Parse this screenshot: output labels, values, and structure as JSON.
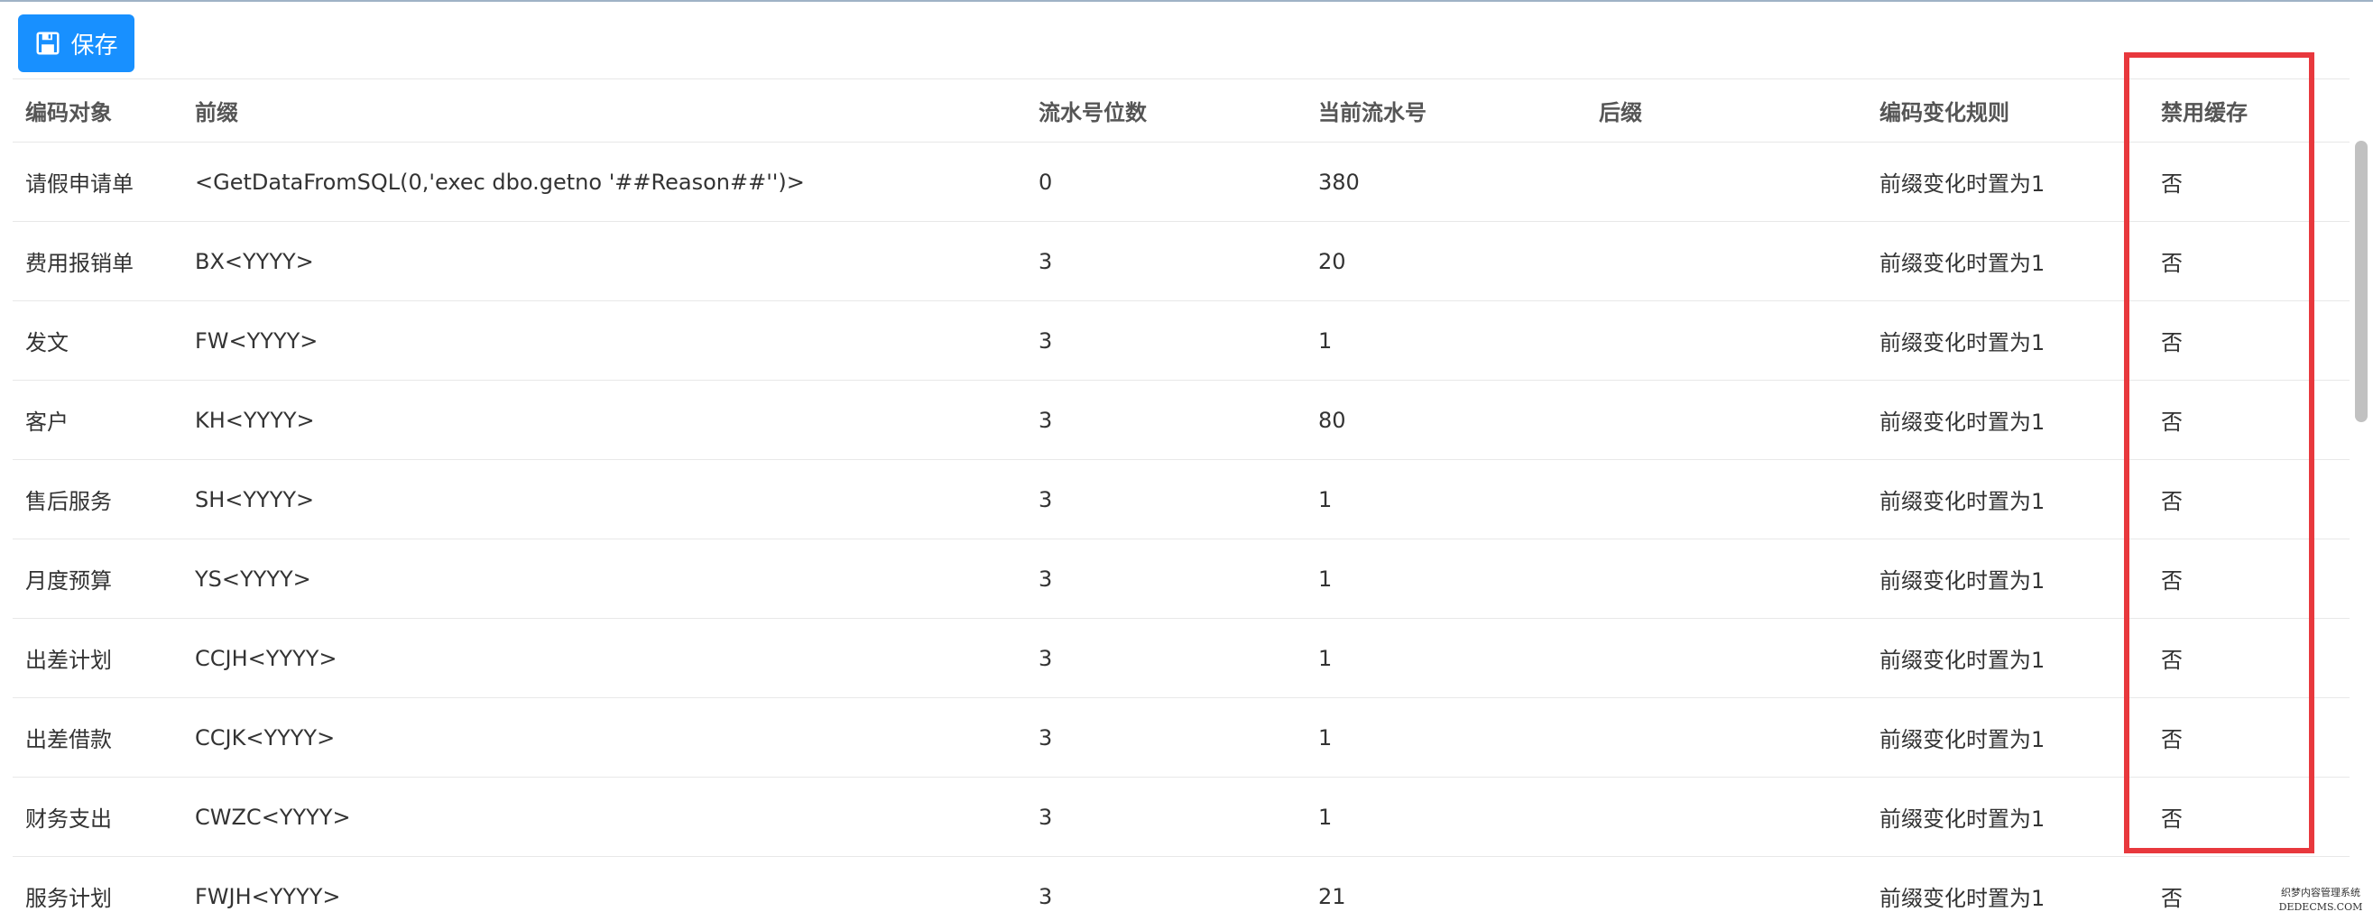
{
  "toolbar": {
    "save_label": "保存",
    "save_icon": "floppy-disk-icon"
  },
  "table": {
    "columns": [
      "编码对象",
      "前缀",
      "流水号位数",
      "当前流水号",
      "后缀",
      "编码变化规则",
      "禁用缓存"
    ],
    "rows": [
      [
        "请假申请单",
        "<GetDataFromSQL(0,'exec dbo.getno '##Reason##'')>",
        "0",
        "380",
        "",
        "前缀变化时置为1",
        "否"
      ],
      [
        "费用报销单",
        "BX<YYYY>",
        "3",
        "20",
        "",
        "前缀变化时置为1",
        "否"
      ],
      [
        "发文",
        "FW<YYYY>",
        "3",
        "1",
        "",
        "前缀变化时置为1",
        "否"
      ],
      [
        "客户",
        "KH<YYYY>",
        "3",
        "80",
        "",
        "前缀变化时置为1",
        "否"
      ],
      [
        "售后服务",
        "SH<YYYY>",
        "3",
        "1",
        "",
        "前缀变化时置为1",
        "否"
      ],
      [
        "月度预算",
        "YS<YYYY>",
        "3",
        "1",
        "",
        "前缀变化时置为1",
        "否"
      ],
      [
        "出差计划",
        "CCJH<YYYY>",
        "3",
        "1",
        "",
        "前缀变化时置为1",
        "否"
      ],
      [
        "出差借款",
        "CCJK<YYYY>",
        "3",
        "1",
        "",
        "前缀变化时置为1",
        "否"
      ],
      [
        "财务支出",
        "CWZC<YYYY>",
        "3",
        "1",
        "",
        "前缀变化时置为1",
        "否"
      ],
      [
        "服务计划",
        "FWJH<YYYY>",
        "3",
        "21",
        "",
        "前缀变化时置为1",
        "否"
      ]
    ]
  },
  "colors": {
    "primary": "#1890ff",
    "highlight": "#e8383d",
    "border": "#e8e8e8"
  },
  "watermark": {
    "line1": "织梦内容管理系统",
    "line2": "DEDECMS.COM"
  }
}
